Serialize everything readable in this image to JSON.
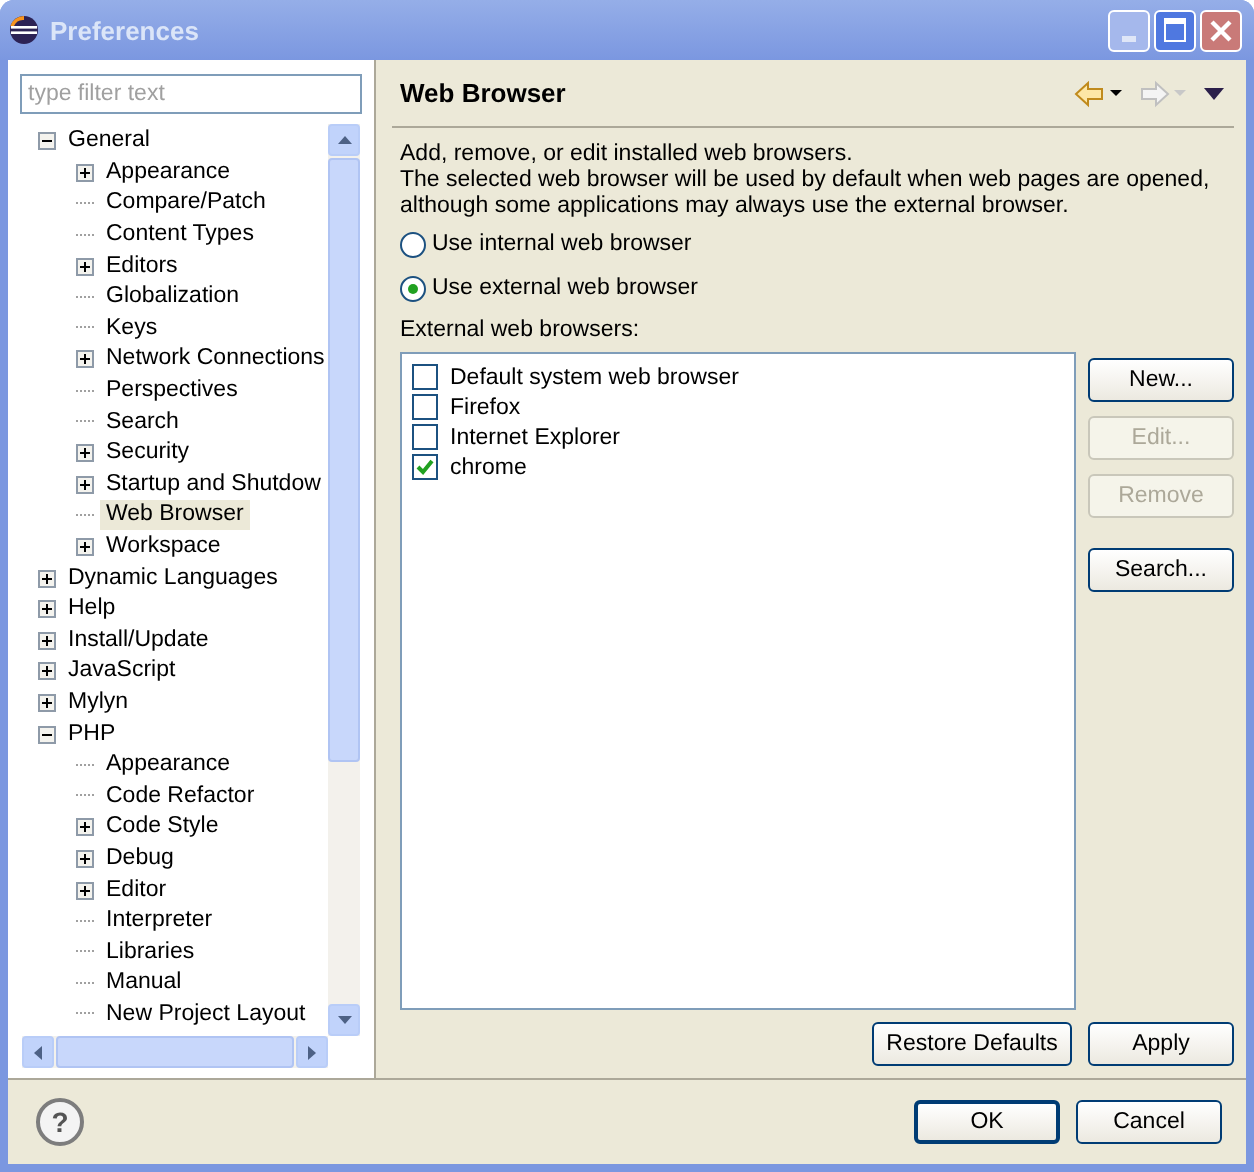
{
  "window": {
    "title": "Preferences"
  },
  "filter": {
    "placeholder": "type filter text"
  },
  "tree": [
    {
      "label": "General",
      "kind": "folder",
      "expanded": true,
      "selected": false,
      "children": [
        {
          "label": "Appearance",
          "kind": "folder",
          "expanded": false,
          "selected": false
        },
        {
          "label": "Compare/Patch",
          "kind": "leaf",
          "selected": false
        },
        {
          "label": "Content Types",
          "kind": "leaf",
          "selected": false
        },
        {
          "label": "Editors",
          "kind": "folder",
          "expanded": false,
          "selected": false
        },
        {
          "label": "Globalization",
          "kind": "leaf",
          "selected": false
        },
        {
          "label": "Keys",
          "kind": "leaf",
          "selected": false
        },
        {
          "label": "Network Connections",
          "kind": "folder",
          "expanded": false,
          "selected": false
        },
        {
          "label": "Perspectives",
          "kind": "leaf",
          "selected": false
        },
        {
          "label": "Search",
          "kind": "leaf",
          "selected": false
        },
        {
          "label": "Security",
          "kind": "folder",
          "expanded": false,
          "selected": false
        },
        {
          "label": "Startup and Shutdow",
          "kind": "folder",
          "expanded": false,
          "selected": false
        },
        {
          "label": "Web Browser",
          "kind": "leaf",
          "selected": true
        },
        {
          "label": "Workspace",
          "kind": "folder",
          "expanded": false,
          "selected": false
        }
      ]
    },
    {
      "label": "Dynamic Languages",
      "kind": "folder",
      "expanded": false,
      "selected": false
    },
    {
      "label": "Help",
      "kind": "folder",
      "expanded": false,
      "selected": false
    },
    {
      "label": "Install/Update",
      "kind": "folder",
      "expanded": false,
      "selected": false
    },
    {
      "label": "JavaScript",
      "kind": "folder",
      "expanded": false,
      "selected": false
    },
    {
      "label": "Mylyn",
      "kind": "folder",
      "expanded": false,
      "selected": false
    },
    {
      "label": "PHP",
      "kind": "folder",
      "expanded": true,
      "selected": false,
      "children": [
        {
          "label": "Appearance",
          "kind": "leaf",
          "selected": false
        },
        {
          "label": "Code Refactor",
          "kind": "leaf",
          "selected": false
        },
        {
          "label": "Code Style",
          "kind": "folder",
          "expanded": false,
          "selected": false
        },
        {
          "label": "Debug",
          "kind": "folder",
          "expanded": false,
          "selected": false
        },
        {
          "label": "Editor",
          "kind": "folder",
          "expanded": false,
          "selected": false
        },
        {
          "label": "Interpreter",
          "kind": "leaf",
          "selected": false
        },
        {
          "label": "Libraries",
          "kind": "leaf",
          "selected": false
        },
        {
          "label": "Manual",
          "kind": "leaf",
          "selected": false
        },
        {
          "label": "New Project Layout",
          "kind": "leaf",
          "selected": false
        }
      ]
    }
  ],
  "page": {
    "title": "Web Browser",
    "description": [
      "Add, remove, or edit installed web browsers.",
      "The selected web browser will be used by default when web pages are opened,",
      "although some applications may always use the external browser."
    ],
    "radios": [
      {
        "label": "Use internal web browser",
        "selected": false
      },
      {
        "label": "Use external web browser",
        "selected": true
      }
    ],
    "list_label": "External web browsers:",
    "browsers": [
      {
        "label": "Default system web browser",
        "checked": false
      },
      {
        "label": "Firefox",
        "checked": false
      },
      {
        "label": "Internet Explorer",
        "checked": false
      },
      {
        "label": "chrome",
        "checked": true
      }
    ],
    "side_buttons": [
      {
        "label": "New...",
        "disabled": false
      },
      {
        "label": "Edit...",
        "disabled": true
      },
      {
        "label": "Remove",
        "disabled": true
      },
      {
        "label": "Search...",
        "disabled": false
      }
    ],
    "page_buttons": [
      "Restore Defaults",
      "Apply"
    ]
  },
  "dialog_buttons": [
    "OK",
    "Cancel"
  ],
  "help_icon": "?"
}
